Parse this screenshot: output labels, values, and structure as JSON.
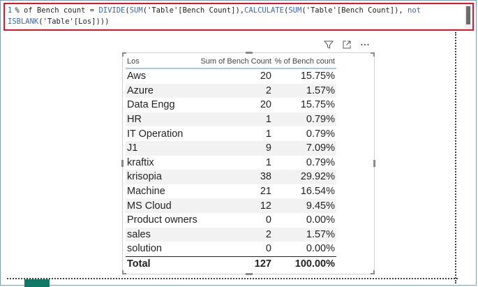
{
  "formula": {
    "line_number": "1",
    "measure_name": "% of Bench count",
    "equals": " = ",
    "fn_divide": "DIVIDE",
    "fn_sum1": "SUM",
    "arg1": "'Table'[Bench Count]",
    "fn_calculate": "CALCULATE",
    "fn_sum2": "SUM",
    "arg2": "'Table'[Bench Count]",
    "kw_not": "not",
    "fn_isblank": "ISBLANK",
    "arg3": "'Table'[Los]",
    "tail": ")))"
  },
  "table": {
    "headers": [
      "Los",
      "Sum of Bench Count",
      "% of Bench count"
    ],
    "rows": [
      [
        "Aws",
        "20",
        "15.75%"
      ],
      [
        "Azure",
        "2",
        "1.57%"
      ],
      [
        "Data Engg",
        "20",
        "15.75%"
      ],
      [
        "HR",
        "1",
        "0.79%"
      ],
      [
        "IT Operation",
        "1",
        "0.79%"
      ],
      [
        "J1",
        "9",
        "7.09%"
      ],
      [
        "kraftix",
        "1",
        "0.79%"
      ],
      [
        "krisopia",
        "38",
        "29.92%"
      ],
      [
        "Machine",
        "21",
        "16.54%"
      ],
      [
        "MS Cloud",
        "12",
        "9.45%"
      ],
      [
        "Product owners",
        "0",
        "0.00%"
      ],
      [
        "sales",
        "2",
        "1.57%"
      ],
      [
        "solution",
        "0",
        "0.00%"
      ]
    ],
    "total": [
      "Total",
      "127",
      "100.00%"
    ]
  },
  "icons": {
    "filter": "filter-icon",
    "focus": "focus-mode-icon",
    "more": "more-options-icon"
  },
  "colors": {
    "highlight_border": "#e8112d",
    "header_underline": "#a9c7e6",
    "alt_row": "#f2f2f2",
    "dax_function": "#3b66b6"
  }
}
